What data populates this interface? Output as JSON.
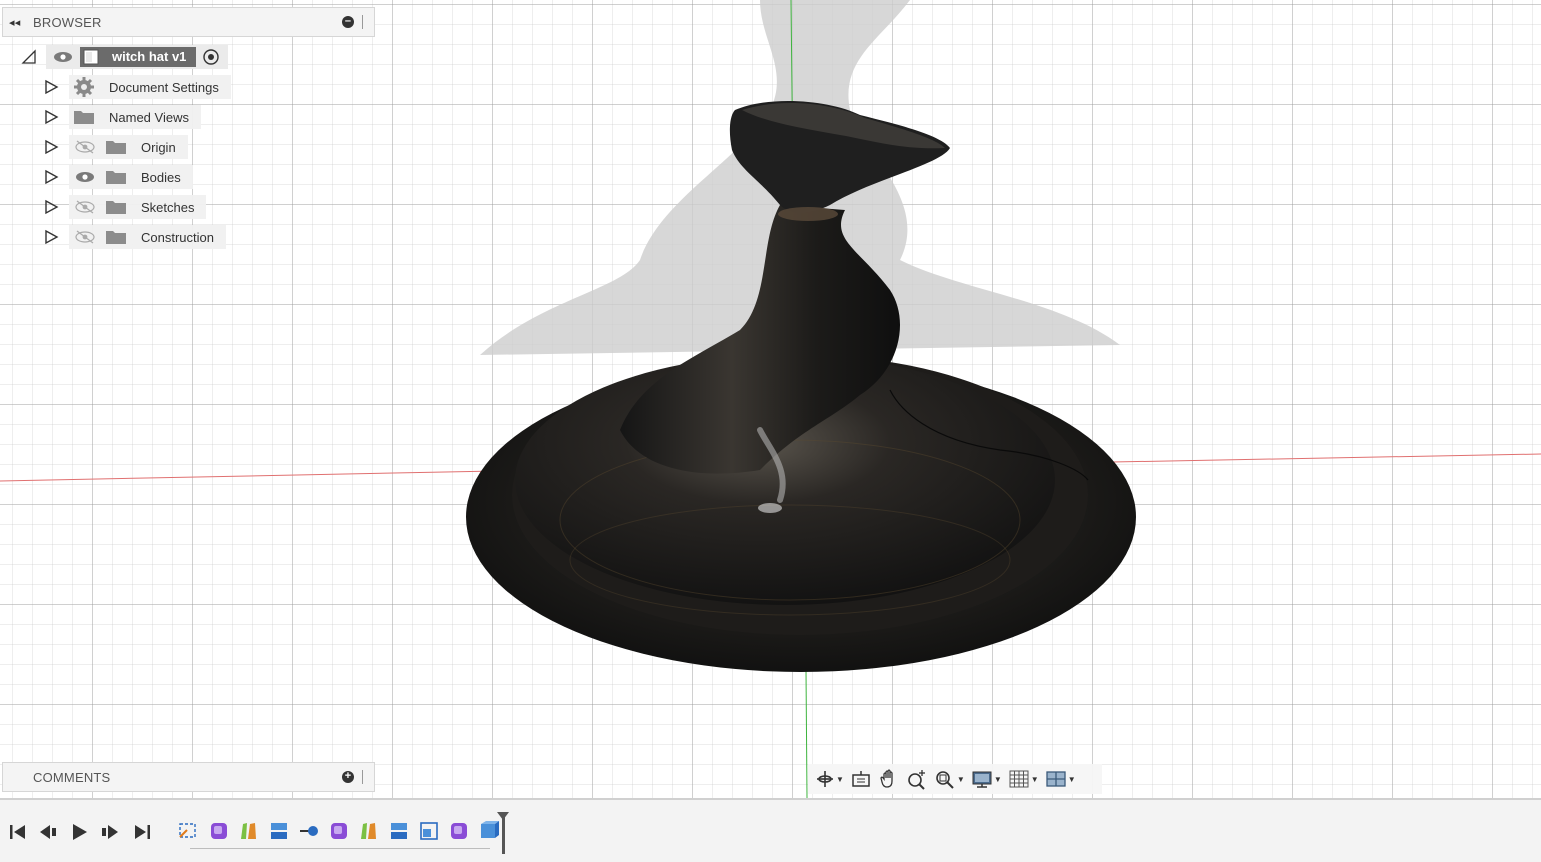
{
  "browser": {
    "title": "BROWSER",
    "root": {
      "label": "witch hat v1"
    },
    "items": [
      {
        "label": "Document Settings",
        "icon": "gear-icon",
        "visibility": "none"
      },
      {
        "label": "Named Views",
        "icon": "folder-icon",
        "visibility": "none"
      },
      {
        "label": "Origin",
        "icon": "folder-icon",
        "visibility": "hidden"
      },
      {
        "label": "Bodies",
        "icon": "folder-icon",
        "visibility": "visible"
      },
      {
        "label": "Sketches",
        "icon": "folder-icon",
        "visibility": "hidden"
      },
      {
        "label": "Construction",
        "icon": "folder-icon",
        "visibility": "hidden"
      }
    ]
  },
  "comments": {
    "title": "COMMENTS"
  },
  "navbar": {
    "tools": [
      "orbit-icon",
      "look-at-icon",
      "pan-icon",
      "zoom-icon",
      "fit-icon",
      "display-settings-icon",
      "grid-settings-icon",
      "viewports-icon"
    ]
  },
  "timeline": {
    "controls": [
      "skip-to-start-icon",
      "step-back-icon",
      "play-icon",
      "step-forward-icon",
      "skip-to-end-icon"
    ],
    "features": [
      "sketch",
      "form",
      "loft",
      "extrude",
      "combine",
      "form",
      "loft",
      "extrude",
      "shell",
      "form",
      "extrude"
    ]
  },
  "colors": {
    "axis_x": "#e07070",
    "axis_y": "#3fb43f",
    "model": "#1a1a1a",
    "shadow": "#c8c8c8",
    "root_label_bg": "#6b6b6b"
  }
}
